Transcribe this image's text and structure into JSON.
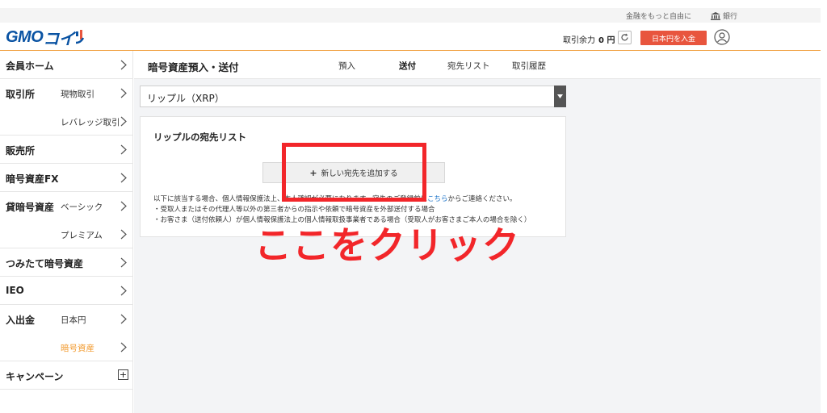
{
  "utility": {
    "freedom_link": "金融をもっと自由に",
    "bank_link": "銀行"
  },
  "header": {
    "logo_gmo": "GMO",
    "logo_coin": "コイ",
    "balance_label": "取引余力",
    "balance_value": "0 円",
    "deposit_button": "日本円を入金",
    "brand_color": "#0a53a3",
    "accent_color": "#e8553e"
  },
  "sidebar": {
    "items": [
      {
        "label": "会員ホーム",
        "sub": ""
      },
      {
        "label": "取引所",
        "sub": "現物取引"
      },
      {
        "label": "",
        "sub": "レバレッジ取引"
      },
      {
        "label": "販売所",
        "sub": ""
      },
      {
        "label": "暗号資産FX",
        "sub": ""
      },
      {
        "label": "貸暗号資産",
        "sub": "ベーシック"
      },
      {
        "label": "",
        "sub": "プレミアム"
      },
      {
        "label": "つみたて暗号資産",
        "sub": ""
      },
      {
        "label": "IEO",
        "sub": ""
      },
      {
        "label": "入出金",
        "sub": "日本円"
      },
      {
        "label": "",
        "sub": "暗号資産"
      },
      {
        "label": "キャンペーン",
        "sub": ""
      }
    ],
    "active_color": "#f29a2e"
  },
  "content": {
    "title": "暗号資産預入・送付",
    "tabs": [
      "預入",
      "送付",
      "宛先リスト",
      "取引履歴"
    ],
    "active_tab": "送付",
    "currency_select": "リップル（XRP）",
    "card_title": "リップルの宛先リスト",
    "add_button": "新しい宛先を追加する",
    "notes": {
      "line1_pre": "以下に該当する場合、個人情報保護法",
      "line1_mid": "上、本人確認が必要になります。宛先のご登録前に",
      "line1_link": "こちら",
      "line1_post": "からご連絡ください。",
      "line2": "・受取人またはその代理人等以外の第三者からの指示や依頼で暗号資産を外部送付する場合",
      "line3": "・お客さま（送付依頼人）が個人情報保護法上の個人情報取扱事業者である場合（受取人がお客さまご本人の場合を除く）"
    }
  },
  "overlay": {
    "annotation": "ここをクリック",
    "color": "#f2262a"
  }
}
